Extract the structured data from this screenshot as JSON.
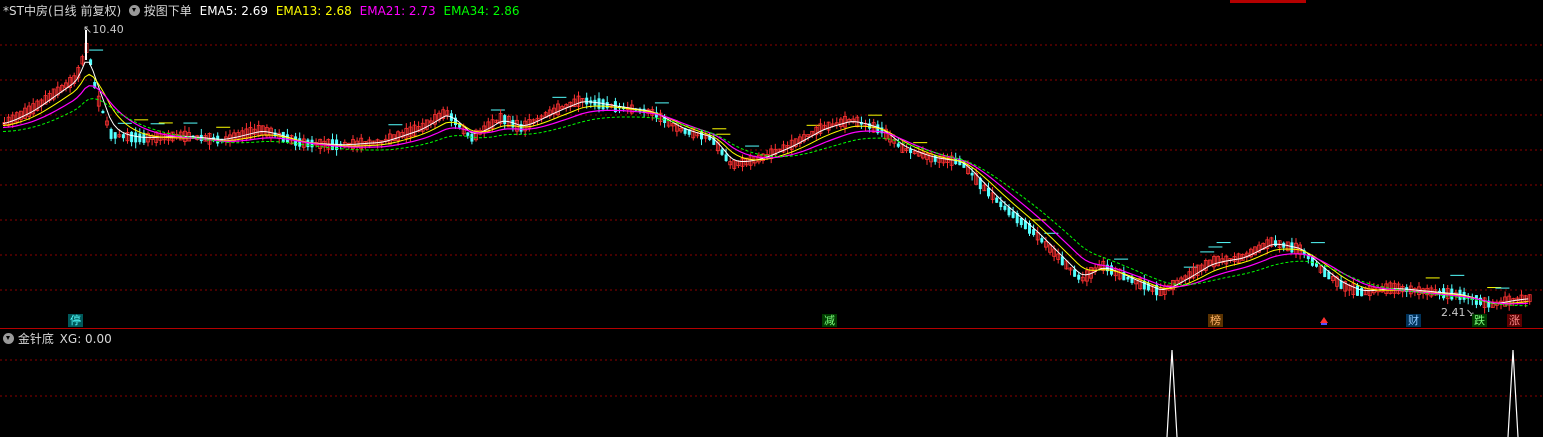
{
  "header": {
    "title": "*ST中房(日线 前复权)",
    "order_label": "按图下单",
    "ema5_label": "EMA5: 2.69",
    "ema13_label": "EMA13: 2.68",
    "ema21_label": "EMA21: 2.73",
    "ema34_label": "EMA34: 2.86"
  },
  "indicator": {
    "name": "金针底",
    "xg_label": "XG: 0.00"
  },
  "markers": {
    "stop": "停",
    "reduce": "减",
    "rank": "榜",
    "finance": "财",
    "fall": "跌",
    "rise": "涨"
  },
  "price_labels": {
    "high": "10.40",
    "low": "2.41"
  },
  "colors": {
    "ema5": "#ffffff",
    "ema13": "#ffff00",
    "ema21": "#ff00ff",
    "ema34": "#00ff00",
    "up": "#ff3232",
    "down": "#54ffff",
    "grid": "#8b0000",
    "divider": "#b40000"
  },
  "chart_data": {
    "type": "candlestick",
    "series": [
      {
        "name": "EMA5",
        "values": [
          2.69
        ]
      },
      {
        "name": "EMA13",
        "values": [
          2.68
        ]
      },
      {
        "name": "EMA21",
        "values": [
          2.73
        ]
      },
      {
        "name": "EMA34",
        "values": [
          2.86
        ]
      },
      {
        "name": "XG",
        "values": [
          0.0
        ]
      }
    ],
    "annotations": [
      "10.40",
      "2.41"
    ]
  }
}
